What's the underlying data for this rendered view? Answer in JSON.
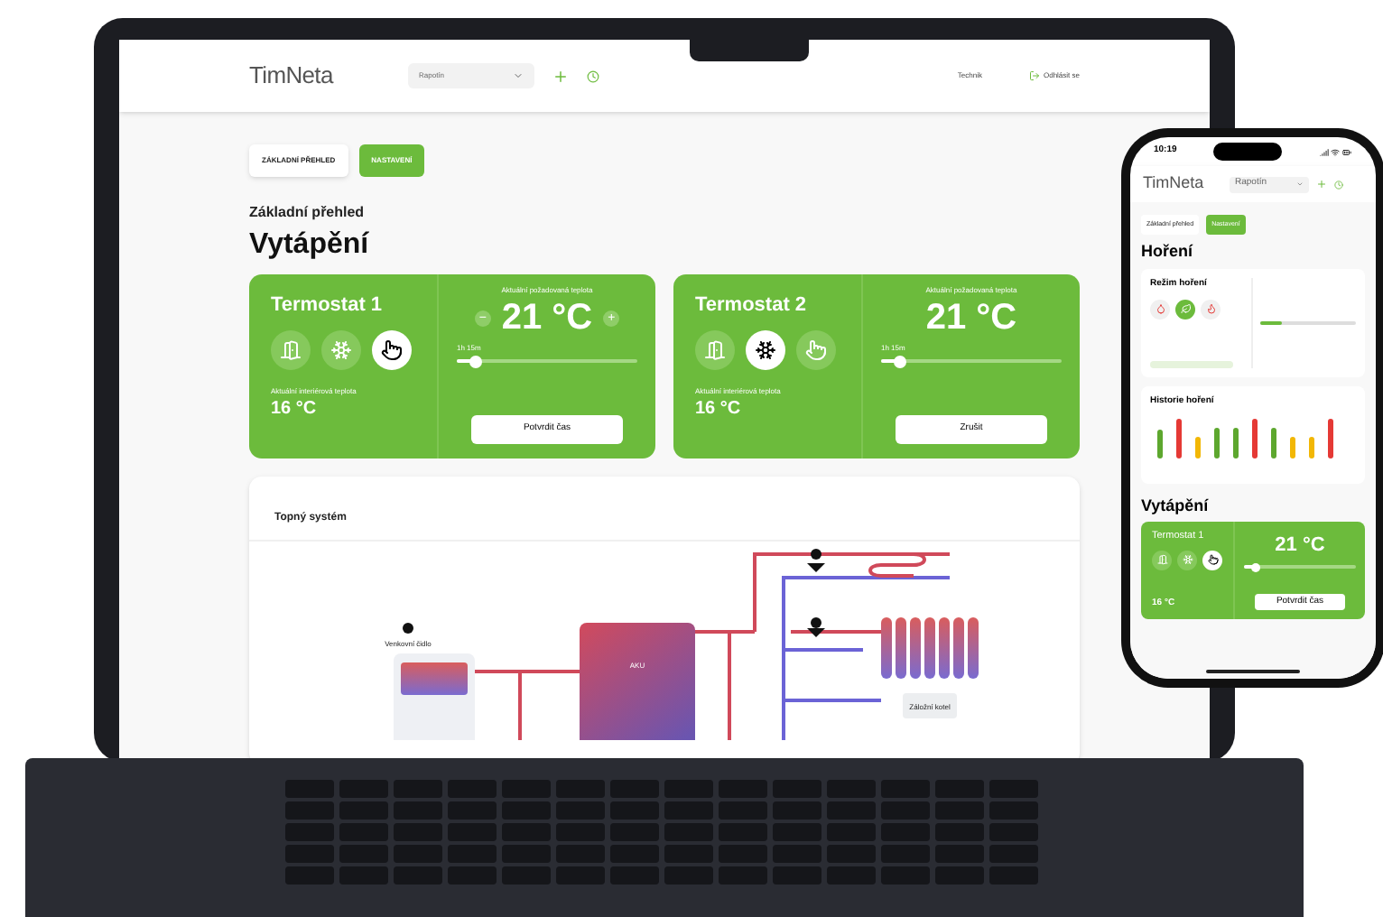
{
  "laptop": {
    "header": {
      "logo": "TimNeta",
      "location_select": {
        "value": "Rapotín"
      },
      "user": "Technik",
      "logout": "Odhlásit se"
    },
    "tabs": [
      {
        "label": "ZÁKLADNÍ PŘEHLED",
        "selected": false
      },
      {
        "label": "NASTAVENÍ",
        "selected": true
      }
    ],
    "breadcrumb": "Základní přehled",
    "title": "Vytápění",
    "thermostats": [
      {
        "name": "Termostat 1",
        "modes": [
          {
            "kind": "door",
            "selected": false
          },
          {
            "kind": "snow",
            "selected": false
          },
          {
            "kind": "hand",
            "selected": true
          }
        ],
        "interior_label": "Aktuální interiérová teplota",
        "interior_temp": "16 °C",
        "target_label": "Aktuální požadovaná teplota",
        "target_temp": "21 °C",
        "minus": "−",
        "plus": "+",
        "timer": "1h 15m",
        "level": 0.1,
        "button": "Potvrdit čas"
      },
      {
        "name": "Termostat 2",
        "modes": [
          {
            "kind": "door",
            "selected": false
          },
          {
            "kind": "snow",
            "selected": true
          },
          {
            "kind": "hand",
            "selected": false
          }
        ],
        "interior_label": "Aktuální interiérová teplota",
        "interior_temp": "16 °C",
        "target_label": "Aktuální požadovaná teplota",
        "target_temp": "21 °C",
        "timer": "1h 15m",
        "level": 0.1,
        "button": "Zrušit"
      }
    ],
    "heating_system": {
      "title": "Topný systém",
      "labels": [
        {
          "kind": "sensor",
          "text": "Venkovní čidlo"
        },
        {
          "kind": "tank",
          "text": "AKU"
        },
        {
          "kind": "boiler",
          "text": "Záložní kotel"
        }
      ]
    }
  },
  "phone": {
    "time": "10:19",
    "logo": "TimNeta",
    "location_select": {
      "value": "Rapotín"
    },
    "tabs": [
      {
        "label": "Základní přehled",
        "selected": false
      },
      {
        "label": "Nastavení",
        "selected": true
      }
    ],
    "section_title": "Hoření",
    "burn_mode": {
      "title": "Režim hoření",
      "modes": [
        {
          "kind": "drop",
          "selected": false
        },
        {
          "kind": "leaf",
          "selected": true
        },
        {
          "kind": "flame",
          "selected": false
        }
      ]
    },
    "history": {
      "title": "Historie hoření"
    },
    "heating_title": "Vytápění",
    "thermostat": {
      "name": "Termostat 1",
      "modes": [
        {
          "kind": "door",
          "selected": false
        },
        {
          "kind": "snow",
          "selected": false
        },
        {
          "kind": "hand",
          "selected": true
        }
      ],
      "interior_temp": "16 °C",
      "target_temp": "21 °C",
      "level": 0.12,
      "button": "Potvrdit čas"
    }
  }
}
